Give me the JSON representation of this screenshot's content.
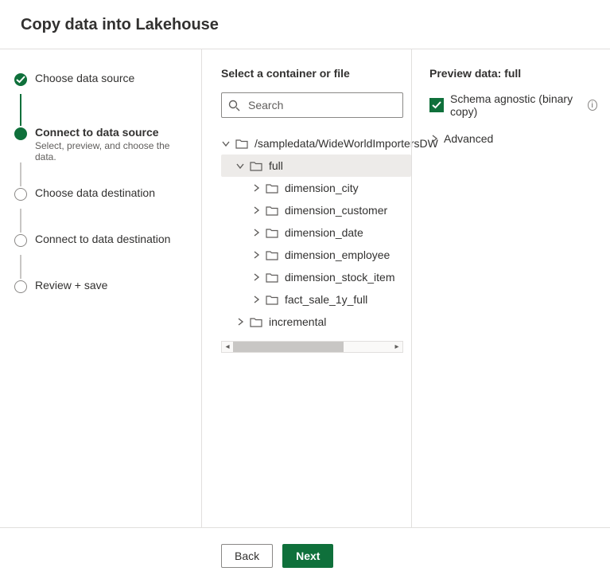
{
  "title": "Copy data into Lakehouse",
  "stepper": [
    {
      "label": "Choose data source",
      "state": "done"
    },
    {
      "label": "Connect to data source",
      "sub": "Select, preview, and choose the data.",
      "state": "current"
    },
    {
      "label": "Choose data destination",
      "state": "future"
    },
    {
      "label": "Connect to data destination",
      "state": "future"
    },
    {
      "label": "Review + save",
      "state": "future"
    }
  ],
  "middle": {
    "title": "Select a container or file",
    "search_placeholder": "Search",
    "tree": [
      {
        "indent": 0,
        "expanded": true,
        "selected": false,
        "label": "/sampledata/WideWorldImportersDW"
      },
      {
        "indent": 1,
        "expanded": true,
        "selected": true,
        "label": "full"
      },
      {
        "indent": 2,
        "expanded": false,
        "selected": false,
        "label": "dimension_city"
      },
      {
        "indent": 2,
        "expanded": false,
        "selected": false,
        "label": "dimension_customer"
      },
      {
        "indent": 2,
        "expanded": false,
        "selected": false,
        "label": "dimension_date"
      },
      {
        "indent": 2,
        "expanded": false,
        "selected": false,
        "label": "dimension_employee"
      },
      {
        "indent": 2,
        "expanded": false,
        "selected": false,
        "label": "dimension_stock_item"
      },
      {
        "indent": 2,
        "expanded": false,
        "selected": false,
        "label": "fact_sale_1y_full"
      },
      {
        "indent": 1,
        "expanded": false,
        "selected": false,
        "label": "incremental"
      }
    ]
  },
  "right": {
    "title": "Preview data: full",
    "checkbox_label": "Schema agnostic (binary copy)",
    "checkbox_checked": true,
    "advanced_label": "Advanced"
  },
  "footer": {
    "back": "Back",
    "next": "Next"
  }
}
